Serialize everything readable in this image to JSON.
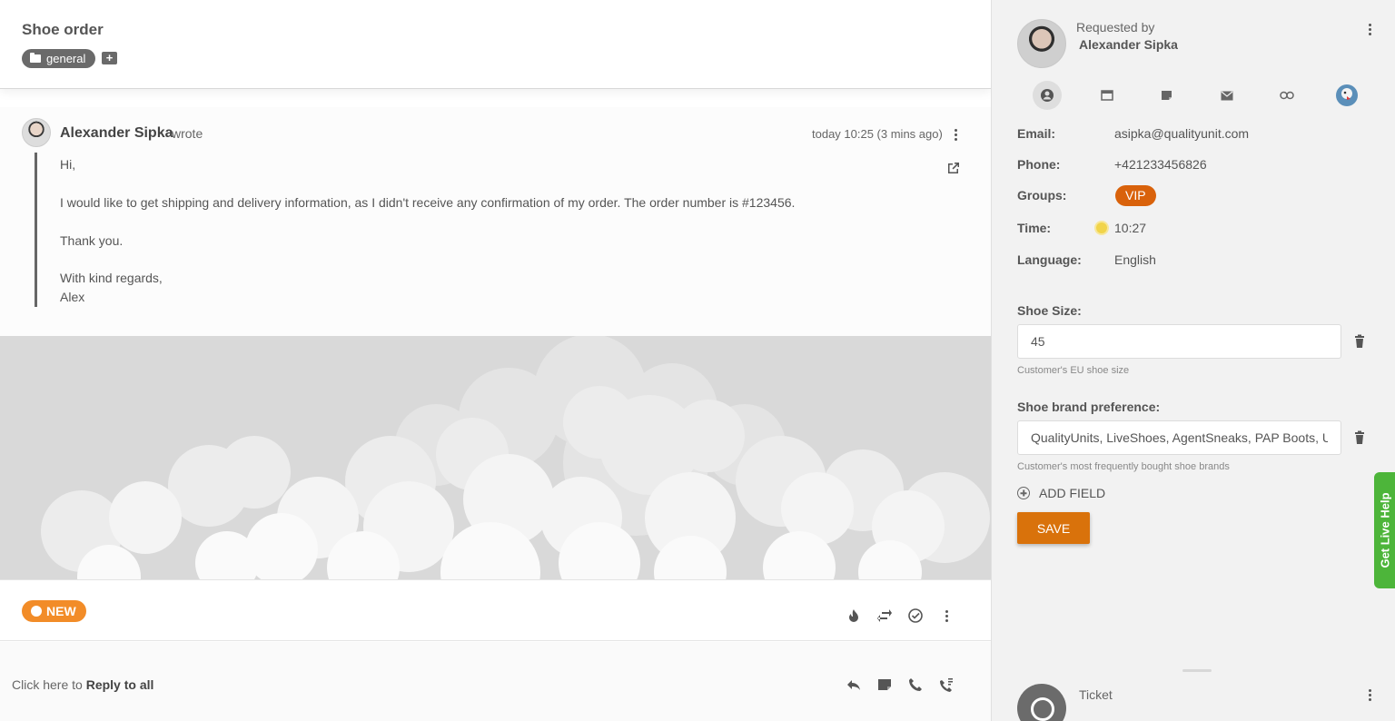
{
  "ticket": {
    "title": "Shoe order",
    "tag": "general"
  },
  "message": {
    "author": "Alexander Sipka",
    "wrote": "wrote",
    "time": "today 10:25 (3 mins ago)",
    "lines": [
      "Hi,",
      "I would like to get shipping and delivery information, as I didn't receive any confirmation of my order. The order number is #123456.",
      "Thank you.",
      "With kind regards,",
      "Alex"
    ]
  },
  "status": {
    "label": "NEW",
    "color": "#f28c28"
  },
  "reply": {
    "prefix": "Click here to ",
    "action": "Reply to all"
  },
  "contact": {
    "requested_by_label": "Requested by",
    "name": "Alexander Sipka",
    "tabs": [
      "person-icon",
      "calendar-icon",
      "folder-icon",
      "mail-icon",
      "link-icon",
      "brand-avatar-icon"
    ],
    "email_label": "Email:",
    "email": "asipka@qualityunit.com",
    "phone_label": "Phone:",
    "phone": "+421233456826",
    "groups_label": "Groups:",
    "group": "VIP",
    "group_color": "#d9620b",
    "time_label": "Time:",
    "time": "10:27",
    "language_label": "Language:",
    "language": "English"
  },
  "fields": {
    "shoe_size": {
      "label": "Shoe Size:",
      "value": "45",
      "hint": "Customer's EU shoe size"
    },
    "shoe_brand": {
      "label": "Shoe brand preference:",
      "value": "QualityUnits, LiveShoes, AgentSneaks, PAP Boots, UR",
      "hint": "Customer's most frequently bought shoe brands"
    },
    "add_field_label": "ADD FIELD",
    "save_label": "SAVE",
    "accent": "#d9720b"
  },
  "bottom": {
    "ticket_label": "Ticket"
  },
  "live_help": {
    "label": "Get Live Help",
    "color": "#4db53a"
  }
}
